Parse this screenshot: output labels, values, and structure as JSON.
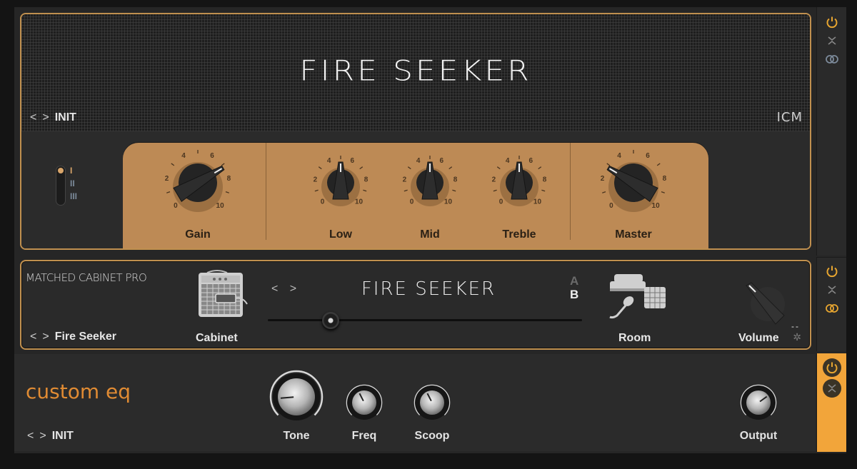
{
  "amp": {
    "title": "FIRE SEEKER",
    "preset_name": "INIT",
    "brand": "ICM",
    "nav_prev": "<",
    "nav_next": ">",
    "channel_switch": {
      "options": [
        "I",
        "II",
        "III"
      ],
      "selected": "I"
    },
    "knobs": [
      {
        "label": "Gain",
        "value": 7.2,
        "scale": [
          "0",
          "2",
          "4",
          "6",
          "8",
          "10"
        ]
      },
      {
        "label": "Low",
        "value": 5,
        "scale": [
          "0",
          "2",
          "4",
          "6",
          "8",
          "10"
        ]
      },
      {
        "label": "Mid",
        "value": 5,
        "scale": [
          "0",
          "2",
          "4",
          "6",
          "8",
          "10"
        ]
      },
      {
        "label": "Treble",
        "value": 5,
        "scale": [
          "0",
          "2",
          "4",
          "6",
          "8",
          "10"
        ]
      },
      {
        "label": "Master",
        "value": 2.8,
        "scale": [
          "0",
          "2",
          "4",
          "6",
          "8",
          "10"
        ]
      }
    ]
  },
  "cabinet": {
    "module_title": "MATCHED CABINET PRO",
    "preset_name": "Fire Seeker",
    "nav_prev": "<",
    "nav_next": ">",
    "cabinet_label": "Cabinet",
    "room_label": "Room",
    "volume_label": "Volume",
    "volume_readout": "--",
    "cab_name": "FIRE SEEKER",
    "ab": {
      "a": "A",
      "b": "B",
      "selected": "B"
    },
    "mic_position": 0.2
  },
  "eq": {
    "title": "custom eq",
    "preset_name": "INIT",
    "nav_prev": "<",
    "nav_next": ">",
    "knobs": [
      {
        "label": "Tone",
        "value": 0.15
      },
      {
        "label": "Freq",
        "value": 0.4
      },
      {
        "label": "Scoop",
        "value": 0.4
      },
      {
        "label": "Output",
        "value": 0.7
      }
    ]
  },
  "strips": {
    "power_icon": "power-icon",
    "collapse_icon": "collapse-icon",
    "link_icon": "link-icon"
  }
}
